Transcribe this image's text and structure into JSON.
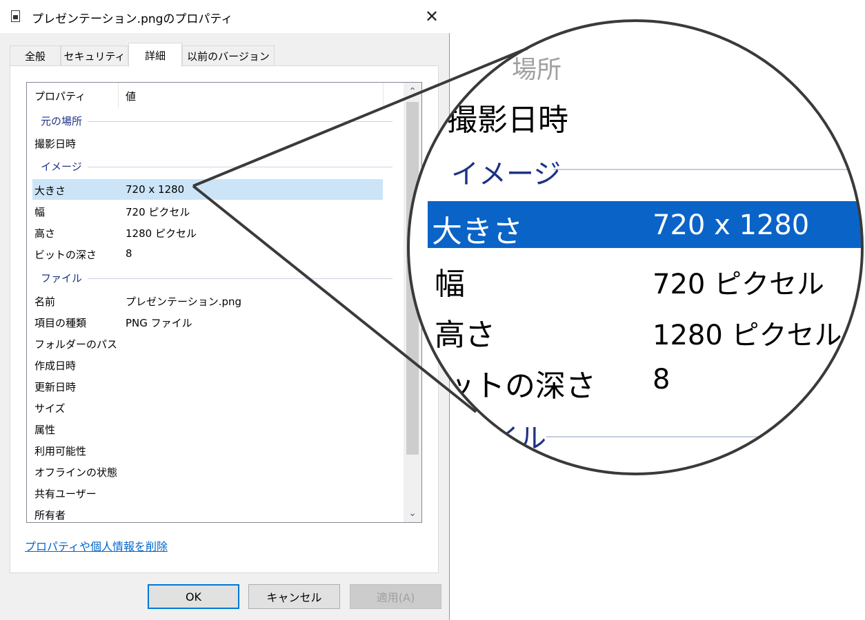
{
  "window": {
    "title": "プレゼンテーション.pngのプロパティ",
    "close_glyph": "✕"
  },
  "tabs": [
    {
      "label": "全般"
    },
    {
      "label": "セキュリティ"
    },
    {
      "label": "詳細",
      "active": true
    },
    {
      "label": "以前のバージョン"
    }
  ],
  "list": {
    "header": {
      "property": "プロパティ",
      "value": "値"
    },
    "groups": {
      "origin": "元の場所",
      "image": "イメージ",
      "file": "ファイル"
    },
    "rows": {
      "date_taken": {
        "key": "撮影日時",
        "value": ""
      },
      "dimensions": {
        "key": "大きさ",
        "value": "720 x 1280"
      },
      "width": {
        "key": "幅",
        "value": "720 ピクセル"
      },
      "height": {
        "key": "高さ",
        "value": "1280 ピクセル"
      },
      "bit_depth": {
        "key": "ビットの深さ",
        "value": "8"
      },
      "name": {
        "key": "名前",
        "value": "プレゼンテーション.png"
      },
      "item_type": {
        "key": "項目の種類",
        "value": "PNG ファイル"
      },
      "folder_path": {
        "key": "フォルダーのパス",
        "value": ""
      },
      "date_created": {
        "key": "作成日時",
        "value": ""
      },
      "date_modified": {
        "key": "更新日時",
        "value": ""
      },
      "size": {
        "key": "サイズ",
        "value": ""
      },
      "attributes": {
        "key": "属性",
        "value": ""
      },
      "availability": {
        "key": "利用可能性",
        "value": ""
      },
      "offline_status": {
        "key": "オフラインの状態",
        "value": ""
      },
      "shared_with": {
        "key": "共有ユーザー",
        "value": ""
      },
      "owner": {
        "key": "所有者",
        "value": ""
      }
    },
    "scroll_up_glyph": "⌃",
    "scroll_down_glyph": "⌄"
  },
  "remove_link": "プロパティや個人情報を削除",
  "buttons": {
    "ok": "OK",
    "cancel": "キャンセル",
    "apply": "適用(A)"
  },
  "zoom": {
    "partial_origin": "場所",
    "date_taken": "撮影日時",
    "image_group": "イメージ",
    "dim_key": "大きさ",
    "dim_value": "720 x 1280",
    "width_key": "幅",
    "width_value": "720 ピクセル",
    "height_key": "高さ",
    "height_value": "1280 ピクセル",
    "depth_key": "ットの深さ",
    "depth_value": "8",
    "file_partial": "イル"
  },
  "colors": {
    "selection": "#cce4f7",
    "zoom_selection": "#0a64c8",
    "link": "#0066cc",
    "group_text": "#1e3287",
    "default_button_border": "#0078d7"
  }
}
